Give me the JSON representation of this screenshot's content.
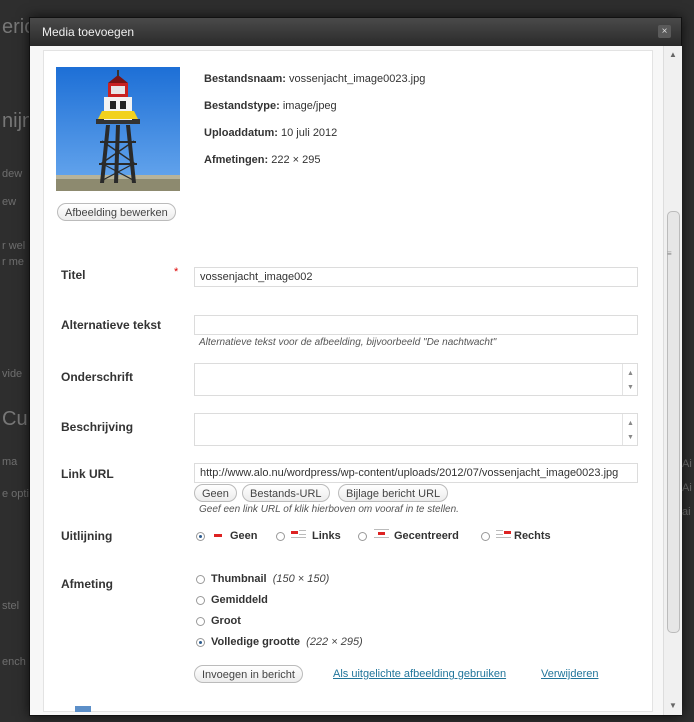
{
  "background": {
    "fragments": [
      "eric",
      "nijn",
      "dew",
      "ew",
      "r wel",
      "r me",
      "vide",
      "Cu",
      "ma",
      "e opti",
      "stel",
      "ench",
      "Ai",
      "Ai",
      "ai"
    ]
  },
  "dialog": {
    "title": "Media toevoegen",
    "close_glyph": "×"
  },
  "file": {
    "name_label": "Bestandsnaam:",
    "name": "vossenjacht_image0023.jpg",
    "type_label": "Bestandstype:",
    "type": "image/jpeg",
    "date_label": "Uploaddatum:",
    "date": "10 juli 2012",
    "dims_label": "Afmetingen:",
    "dims": "222 × 295",
    "edit_button": "Afbeelding bewerken"
  },
  "form": {
    "title_label": "Titel",
    "required_mark": "*",
    "title_value": "vossenjacht_image002",
    "alt_label": "Alternatieve tekst",
    "alt_value": "",
    "alt_help": "Alternatieve tekst voor de afbeelding, bijvoorbeeld \"De nachtwacht\"",
    "caption_label": "Onderschrift",
    "description_label": "Beschrijving",
    "link_label": "Link URL",
    "link_value": "http://www.alo.nu/wordpress/wp-content/uploads/2012/07/vossenjacht_image0023.jpg",
    "link_buttons": [
      "Geen",
      "Bestands-URL",
      "Bijlage bericht URL"
    ],
    "link_help": "Geef een link URL of klik hierboven om vooraf in te stellen.",
    "align_label": "Uitlijning",
    "align_options": [
      {
        "label": "Geen",
        "selected": true
      },
      {
        "label": "Links",
        "selected": false
      },
      {
        "label": "Gecentreerd",
        "selected": false
      },
      {
        "label": "Rechts",
        "selected": false
      }
    ],
    "size_label": "Afmeting",
    "size_options": [
      {
        "label": "Thumbnail",
        "detail": "(150 × 150)",
        "selected": false
      },
      {
        "label": "Gemiddeld",
        "detail": "",
        "selected": false
      },
      {
        "label": "Groot",
        "detail": "",
        "selected": false
      },
      {
        "label": "Volledige grootte",
        "detail": "(222 × 295)",
        "selected": true
      }
    ],
    "insert_button": "Invoegen in bericht",
    "featured_link": "Als uitgelichte afbeelding gebruiken",
    "delete_link": "Verwijderen"
  },
  "colors": {
    "accent_link": "#21759b",
    "required": "#dd0000",
    "align_icon": "#d22222"
  }
}
